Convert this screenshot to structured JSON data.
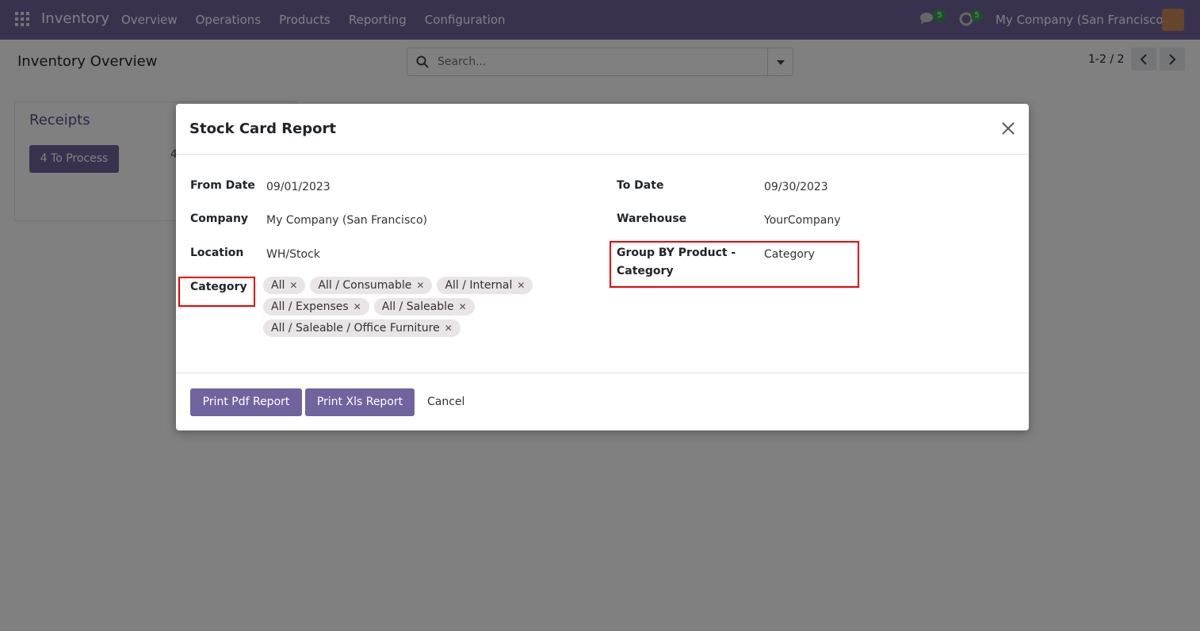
{
  "navbar": {
    "brand": "Inventory",
    "menu": [
      "Overview",
      "Operations",
      "Products",
      "Reporting",
      "Configuration"
    ],
    "chat_count": "5",
    "activity_count": "5",
    "company": "My Company (San Francisco)"
  },
  "control": {
    "title": "Inventory Overview",
    "search_placeholder": "Search...",
    "pager": "1-2 / 2"
  },
  "card": {
    "title": "Receipts",
    "button": "4 To Process",
    "number": "4"
  },
  "modal": {
    "title": "Stock Card Report",
    "fields": {
      "from_date_label": "From Date",
      "from_date_value": "09/01/2023",
      "to_date_label": "To Date",
      "to_date_value": "09/30/2023",
      "company_label": "Company",
      "company_value": "My Company (San Francisco)",
      "warehouse_label": "Warehouse",
      "warehouse_value": "YourCompany",
      "location_label": "Location",
      "location_value": "WH/Stock",
      "group_by_label_1": "Group BY Product -",
      "group_by_label_2": "Category",
      "group_by_value": "Category",
      "category_label": "Category"
    },
    "category_tags": [
      [
        "All",
        "All / Consumable",
        "All / Internal"
      ],
      [
        "All / Expenses",
        "All / Saleable"
      ],
      [
        "All / Saleable / Office Furniture"
      ]
    ],
    "buttons": {
      "pdf": "Print Pdf Report",
      "xls": "Print Xls Report",
      "cancel": "Cancel"
    }
  }
}
